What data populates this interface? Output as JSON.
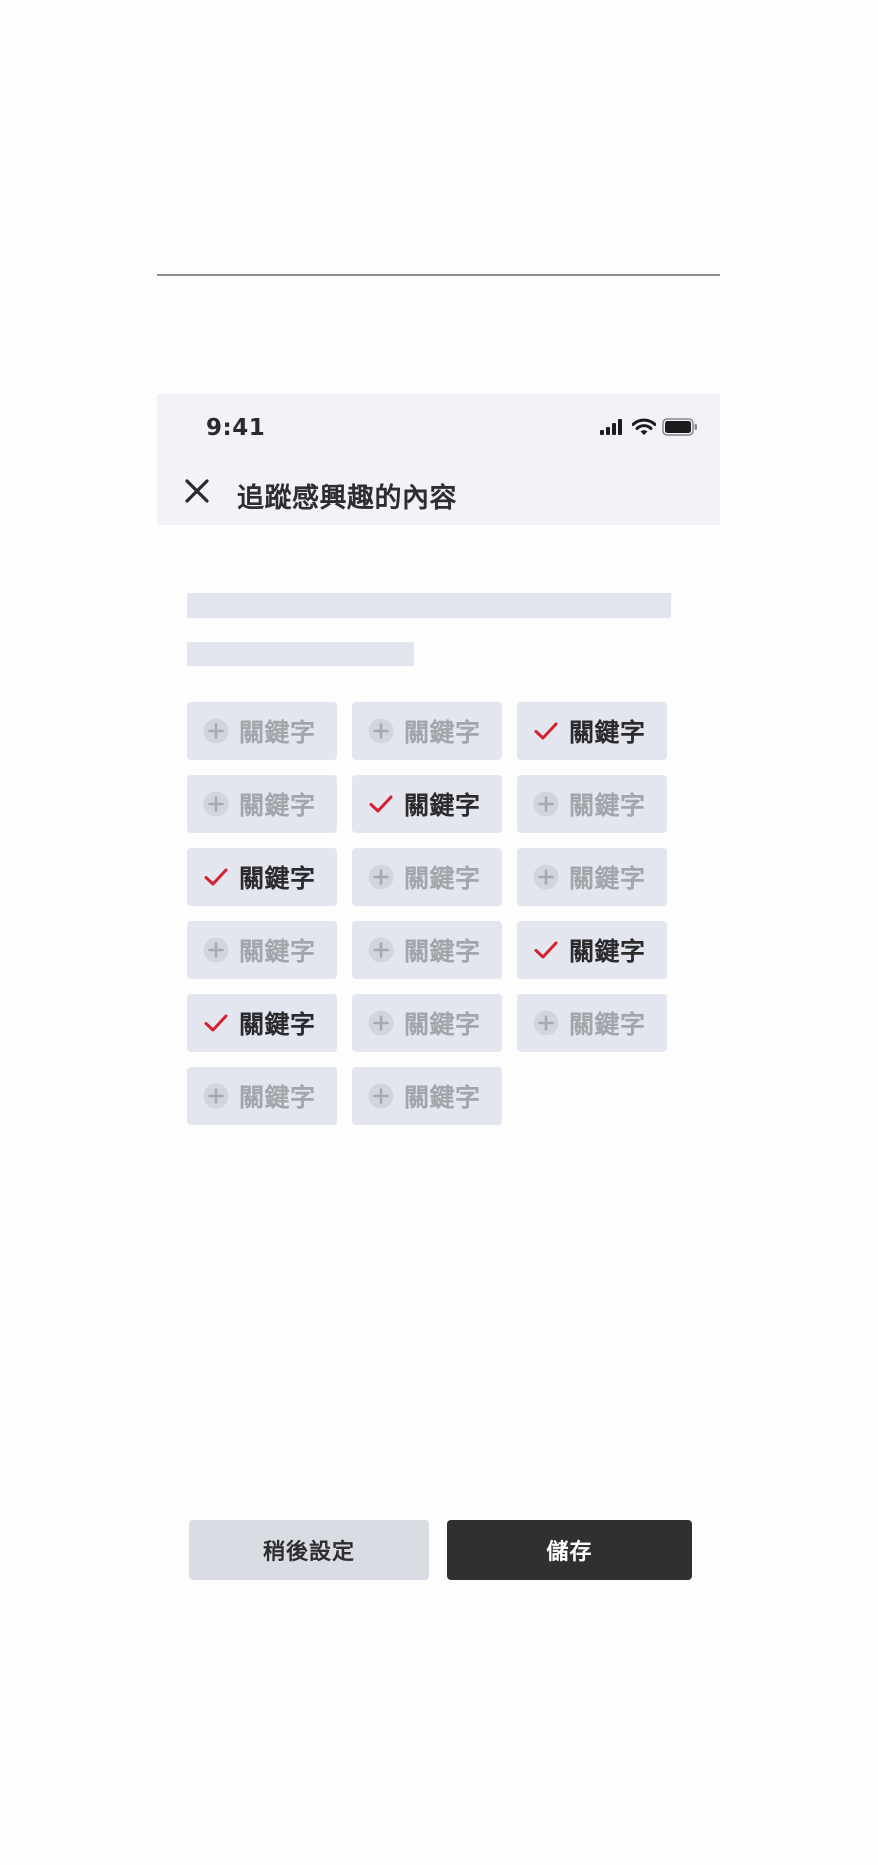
{
  "status_bar": {
    "time": "9:41",
    "icons": [
      "cellular-signal-icon",
      "wifi-icon",
      "battery-icon"
    ]
  },
  "header": {
    "close_icon": "close-icon",
    "title": "追蹤感興趣的內容"
  },
  "keywords": [
    {
      "label": "關鍵字",
      "selected": false
    },
    {
      "label": "關鍵字",
      "selected": false
    },
    {
      "label": "關鍵字",
      "selected": true
    },
    {
      "label": "關鍵字",
      "selected": false
    },
    {
      "label": "關鍵字",
      "selected": true
    },
    {
      "label": "關鍵字",
      "selected": false
    },
    {
      "label": "關鍵字",
      "selected": true
    },
    {
      "label": "關鍵字",
      "selected": false
    },
    {
      "label": "關鍵字",
      "selected": false
    },
    {
      "label": "關鍵字",
      "selected": false
    },
    {
      "label": "關鍵字",
      "selected": false
    },
    {
      "label": "關鍵字",
      "selected": true
    },
    {
      "label": "關鍵字",
      "selected": true
    },
    {
      "label": "關鍵字",
      "selected": false
    },
    {
      "label": "關鍵字",
      "selected": false
    },
    {
      "label": "關鍵字",
      "selected": false
    },
    {
      "label": "關鍵字",
      "selected": false
    }
  ],
  "footer": {
    "later_label": "稍後設定",
    "save_label": "儲存"
  },
  "colors": {
    "header_bg": "#f2f3f6",
    "chip_bg": "#e3e5ef",
    "check_red": "#d4212e",
    "save_button_bg": "#2f3032",
    "later_button_bg": "#d9dce2"
  }
}
